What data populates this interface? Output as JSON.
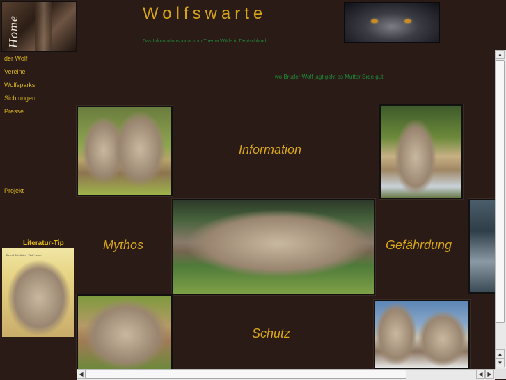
{
  "header": {
    "site_title": "Wolfswarte",
    "subtitle": "Das Informationsportal zum Thema Wölfe in Deutschland",
    "motto": "- wo Bruder Wolf jagt geht es Mutter Erde gut -"
  },
  "sidebar": {
    "home_label": "Home",
    "items": [
      {
        "label": "der Wolf"
      },
      {
        "label": "Vereine"
      },
      {
        "label": "Wolfsparks"
      },
      {
        "label": "Sichtungen"
      },
      {
        "label": "Presse"
      },
      {
        "label": "Projekt"
      }
    ],
    "literature_title": "Literatur-Tip",
    "literature_book_text": "Bernd Schröder · Wolf Leben"
  },
  "sections": {
    "information": "Information",
    "mythos": "Mythos",
    "gefaehrdung": "Gefährdung",
    "schutz": "Schutz"
  },
  "colors": {
    "background": "#2a1b16",
    "accent_gold": "#d7a51a",
    "subtitle_green": "#1f8a3a"
  },
  "icons": {
    "scroll_up": "arrow-up-icon",
    "scroll_down": "arrow-down-icon",
    "scroll_left": "arrow-left-icon",
    "scroll_right": "arrow-right-icon"
  }
}
